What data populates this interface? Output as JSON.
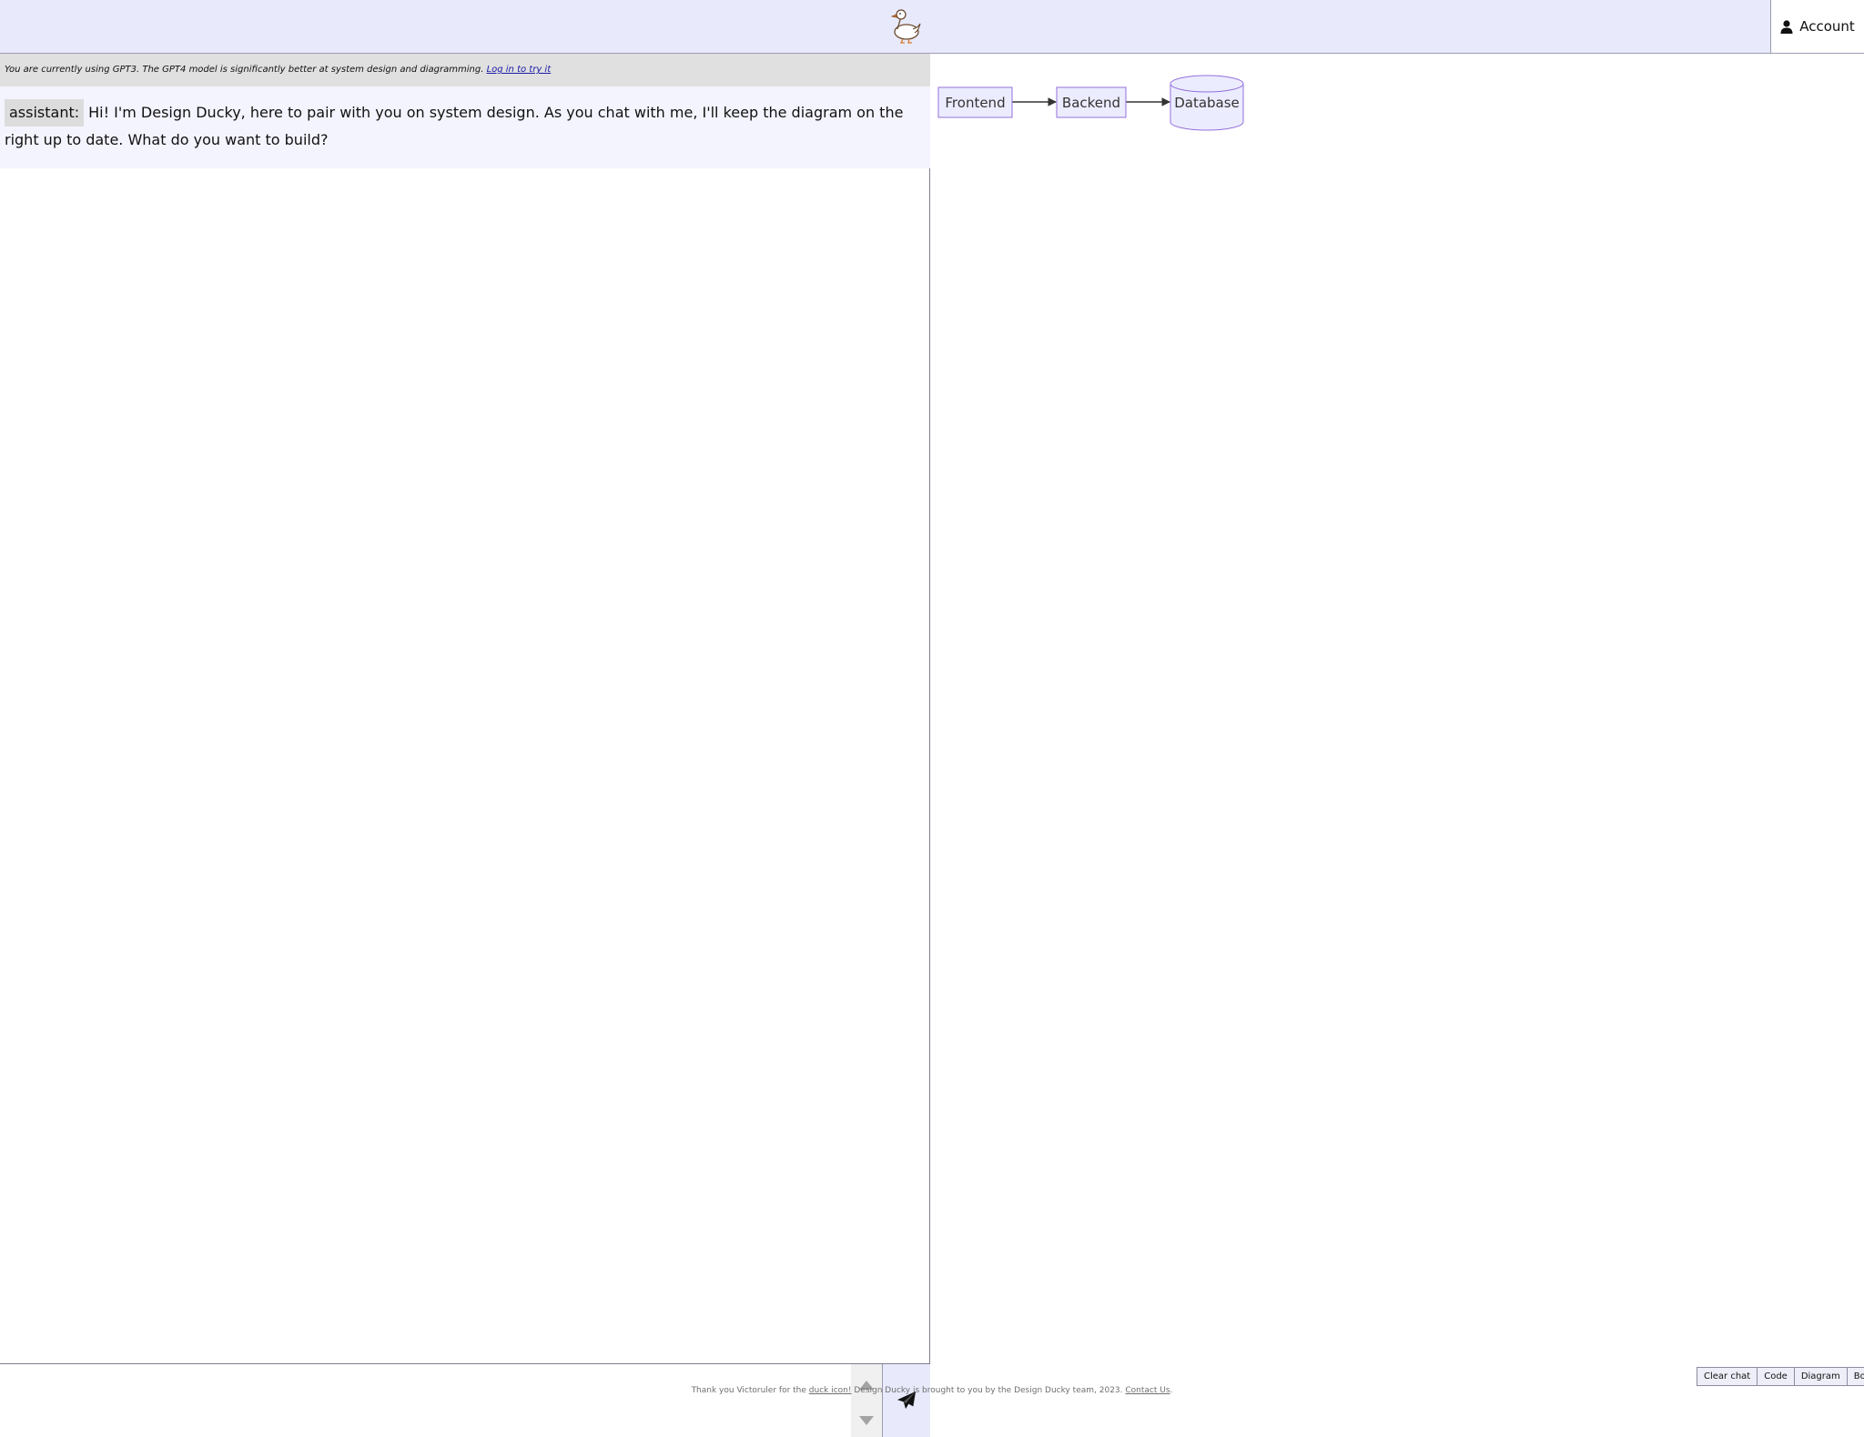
{
  "header": {
    "logo_icon": "duck-icon",
    "account_label": "Account",
    "account_icon": "user-icon"
  },
  "notice": {
    "text": "You are currently using GPT3. The GPT4 model is significantly better at system design and diagramming.",
    "link_label": "Log in to try it"
  },
  "chat": {
    "messages": [
      {
        "role": "assistant:",
        "text": "Hi! I'm Design Ducky, here to pair with you on system design. As you chat with me, I'll keep the diagram on the right up to date. What do you want to build?"
      }
    ],
    "input": {
      "value": "",
      "placeholder": ""
    },
    "send_icon": "paper-plane-icon"
  },
  "diagram": {
    "nodes": [
      {
        "label": "Frontend",
        "shape": "rectangle"
      },
      {
        "label": "Backend",
        "shape": "rectangle"
      },
      {
        "label": "Database",
        "shape": "cylinder"
      }
    ],
    "edges": [
      {
        "from": "Frontend",
        "to": "Backend"
      },
      {
        "from": "Backend",
        "to": "Database"
      }
    ],
    "colors": {
      "node_fill": "#ececff",
      "node_stroke": "#9370db",
      "edge": "#333333"
    }
  },
  "view_controls": {
    "clear_chat": "Clear chat",
    "code": "Code",
    "diagram": "Diagram",
    "both": "Both"
  },
  "footer": {
    "text_before": "Thank you Victoruler for the",
    "duck_link": "duck icon!",
    "text_middle": "Design Ducky is brought to you by the Design Ducky team, 2023.",
    "contact_link": "Contact Us",
    "text_end": "."
  },
  "colors": {
    "header_bg": "#e8eafb",
    "notice_bg": "#e0e0e0",
    "message_bg": "#f4f4ff",
    "role_tag_bg": "#dcdcdc"
  }
}
